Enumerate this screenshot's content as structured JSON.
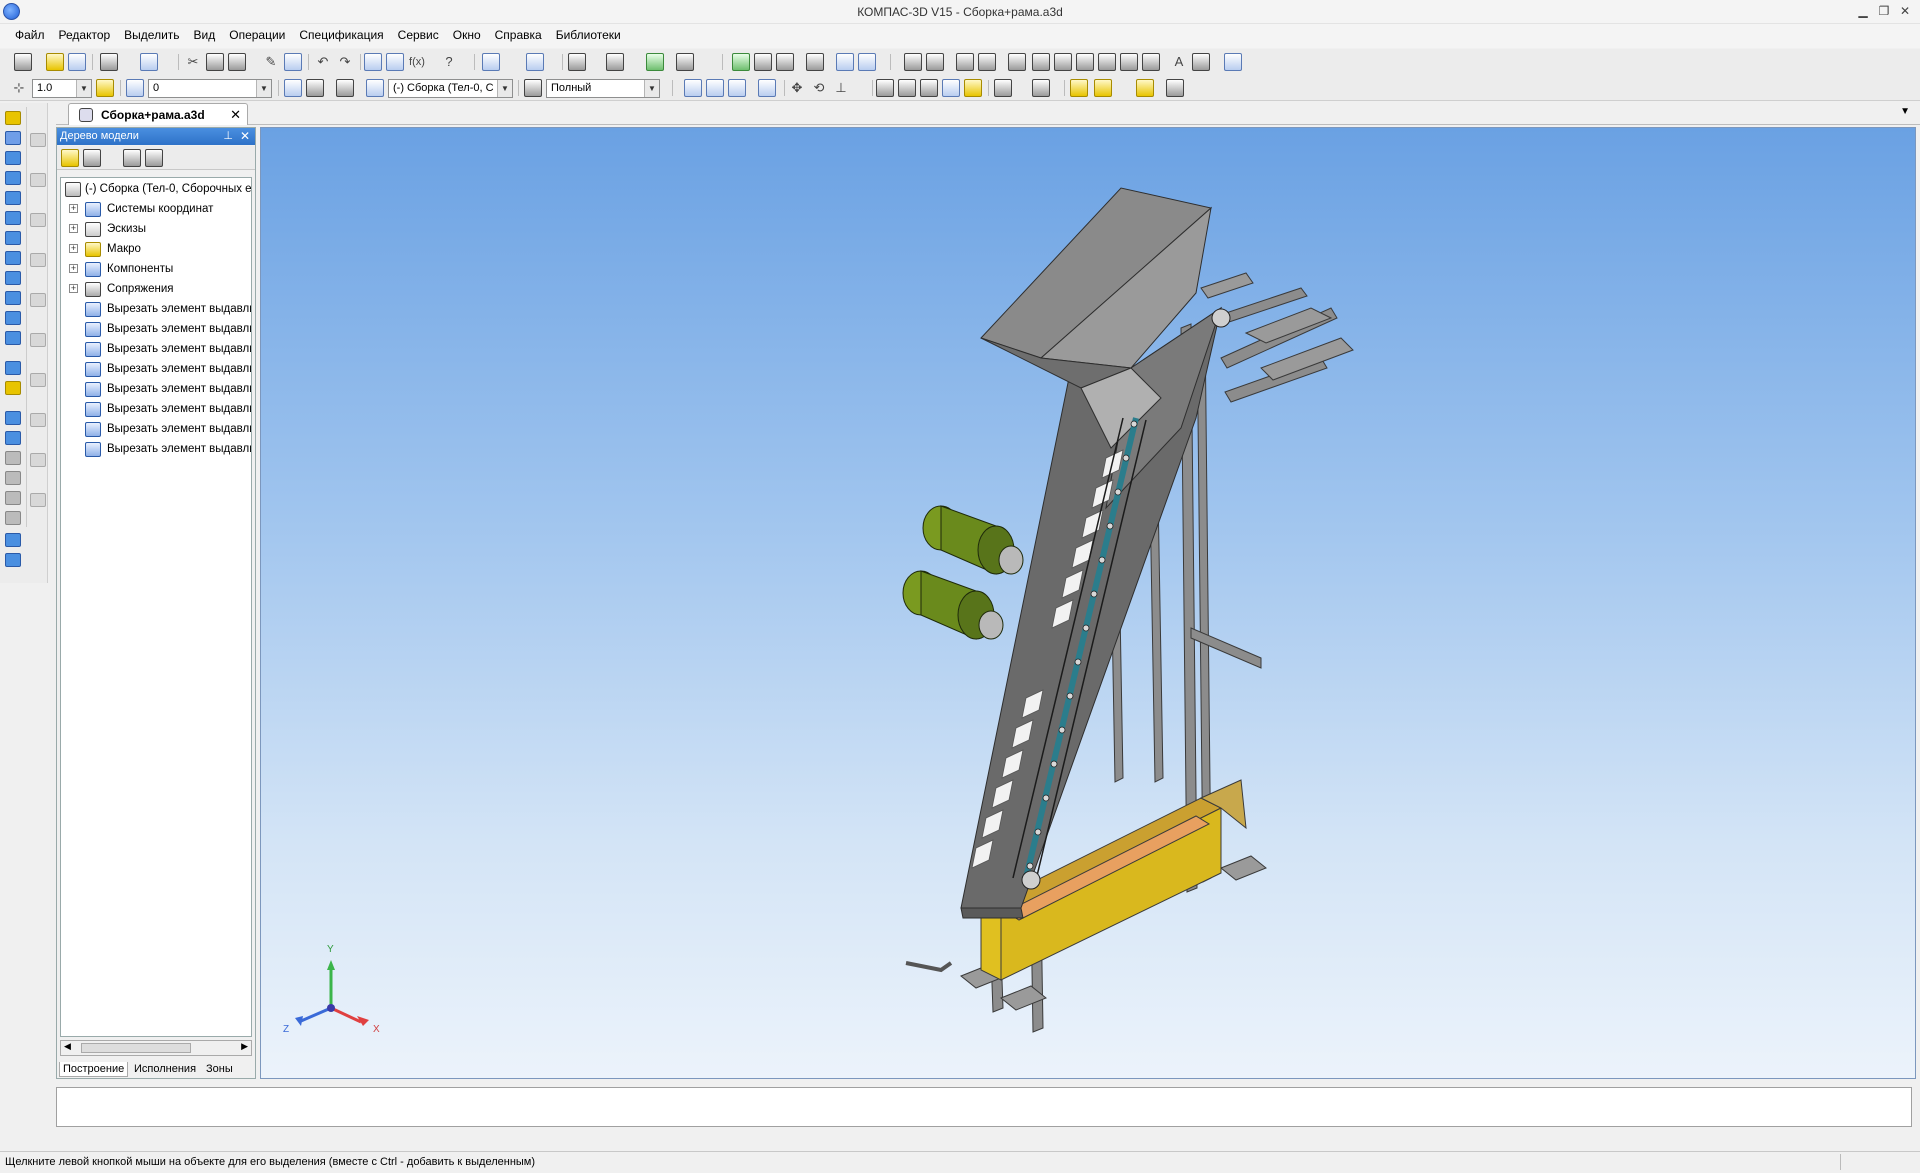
{
  "window": {
    "title": "КОМПАС-3D V15 - Сборка+рама.a3d"
  },
  "menu": [
    "Файл",
    "Редактор",
    "Выделить",
    "Вид",
    "Операции",
    "Спецификация",
    "Сервис",
    "Окно",
    "Справка",
    "Библиотеки"
  ],
  "toolbar": {
    "step_value": "1.0",
    "layer_value": "0",
    "component_value": "(-) Сборка (Тел-0, С",
    "view_mode_value": "Полный"
  },
  "document_tab": {
    "label": "Сборка+рама.a3d"
  },
  "tree": {
    "title": "Дерево модели",
    "root": "(-) Сборка (Тел-0, Сборочных е",
    "groups": [
      "Системы координат",
      "Эскизы",
      "Макро",
      "Компоненты",
      "Сопряжения"
    ],
    "operations": [
      "Вырезать элемент выдавли",
      "Вырезать элемент выдавли",
      "Вырезать элемент выдавли",
      "Вырезать элемент выдавли",
      "Вырезать элемент выдавли",
      "Вырезать элемент выдавли",
      "Вырезать элемент выдавли",
      "Вырезать элемент выдавли"
    ],
    "bottom_tabs": [
      "Построение",
      "Исполнения",
      "Зоны"
    ]
  },
  "axes": {
    "x": "X",
    "y": "Y",
    "z": "Z"
  },
  "status": {
    "message": "Щелкните левой кнопкой мыши на объекте для его выделения (вместе с Ctrl - добавить к выделенным)"
  },
  "colors": {
    "tree_header": "#2e72c8",
    "viewport_top": "#6aa1e3",
    "viewport_bottom": "#ecf3fb",
    "motor": "#6a8a1c",
    "bin": "#e0c020"
  }
}
